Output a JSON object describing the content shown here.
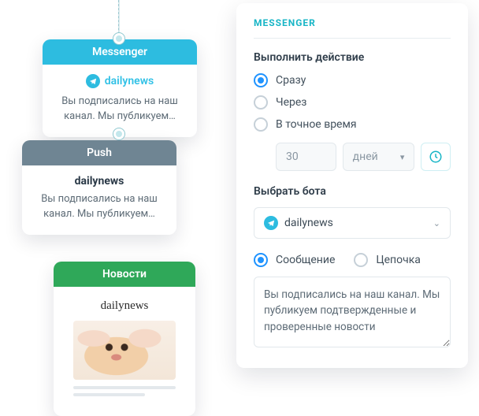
{
  "cards": {
    "messenger": {
      "header": "Messenger",
      "channel_name": "dailynews",
      "preview": "Вы подписались на наш канал. Мы публикуем…"
    },
    "push": {
      "header": "Push",
      "title": "dailynews",
      "preview": "Вы подписались на наш канал. Мы публикуем…"
    },
    "news": {
      "header": "Новости",
      "brand": "dailynews"
    }
  },
  "panel": {
    "title": "MESSENGER",
    "action_label": "Выполнить действие",
    "timing": {
      "options": [
        "Сразу",
        "Через",
        "В точное время"
      ],
      "selected": 0,
      "delay_value": "30",
      "delay_unit": "дней"
    },
    "bot_label": "Выбрать бота",
    "bot_selected": "dailynews",
    "content_type": {
      "options": [
        "Сообщение",
        "Цепочка"
      ],
      "selected": 0
    },
    "message_text": "Вы подписались на наш канал. Мы публикуем подтвержденные и проверенные новости"
  }
}
